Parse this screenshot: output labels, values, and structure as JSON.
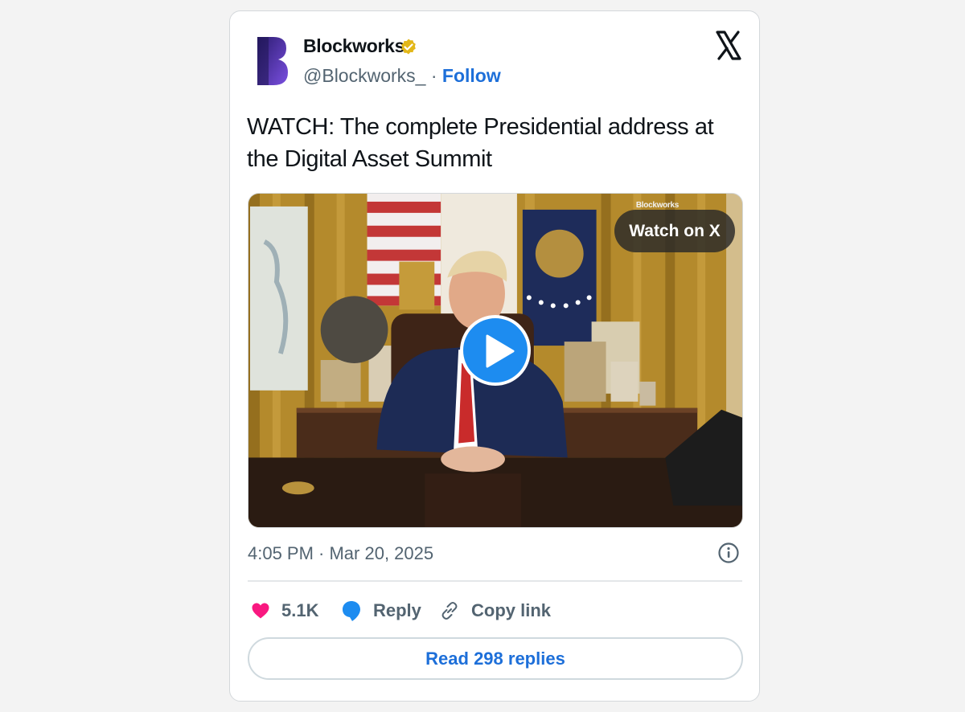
{
  "author": {
    "name": "Blockworks",
    "handle": "@Blockworks_",
    "separator": "·",
    "follow_label": "Follow",
    "verified": true
  },
  "tweet": {
    "text": "WATCH: The complete Presidential address at the Digital Asset Summit",
    "timestamp": "4:05 PM · Mar 20, 2025"
  },
  "media": {
    "type": "video",
    "watermark": "Blockworks",
    "watch_label": "Watch on X"
  },
  "actions": {
    "likes_count": "5.1K",
    "reply_label": "Reply",
    "copy_link_label": "Copy link"
  },
  "read_replies_label": "Read 298 replies",
  "icons": {
    "brand": "x-logo-icon",
    "info": "info-icon",
    "like": "heart-icon",
    "reply": "reply-bubble-icon",
    "copy": "link-icon",
    "play": "play-icon",
    "verified": "verified-badge-icon"
  },
  "colors": {
    "accent": "#1d6fd9",
    "like": "#f91880",
    "play": "#1d8cf0",
    "verified": "#e2b719"
  }
}
